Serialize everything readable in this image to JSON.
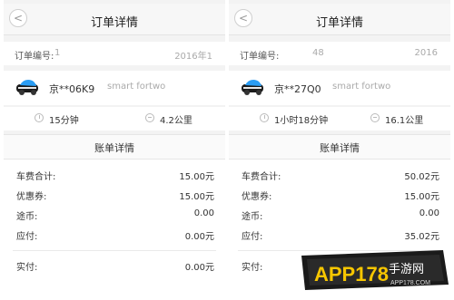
{
  "screens": [
    {
      "title": "订单详情",
      "order_label": "订单编号:",
      "order_id_visible": "1",
      "order_date_visible": "2016年1",
      "plate": "京**06K9",
      "model": "smart fortwo",
      "duration": "15分钟",
      "distance": "4.2公里",
      "bill_title": "账单详情",
      "rows": [
        {
          "label": "车费合计:",
          "value": "15.00元"
        },
        {
          "label": "优惠券:",
          "value": "15.00元"
        },
        {
          "label": "途币:",
          "value": "0.00"
        },
        {
          "label": "应付:",
          "value": "0.00元"
        },
        {
          "label": "实付:",
          "value": "0.00元"
        }
      ]
    },
    {
      "title": "订单详情",
      "order_label": "订单编号:",
      "order_id_visible": "48",
      "order_date_visible": "2016",
      "plate": "京**27Q0",
      "model": "smart fortwo",
      "duration": "1小时18分钟",
      "distance": "16.1公里",
      "bill_title": "账单详情",
      "rows": [
        {
          "label": "车费合计:",
          "value": "50.02元"
        },
        {
          "label": "优惠券:",
          "value": "15.00元"
        },
        {
          "label": "途币:",
          "value": "0.00"
        },
        {
          "label": "应付:",
          "value": "35.02元"
        },
        {
          "label": "实付:",
          "value": ""
        }
      ]
    }
  ],
  "watermark": {
    "text": "APP178",
    "suffix": "手游网",
    "domain": "APP178.COM"
  },
  "colors": {
    "panel_bg": "#f3f3f3",
    "brand_yellow": "#f7c600",
    "brand_orange": "#e58b00"
  }
}
